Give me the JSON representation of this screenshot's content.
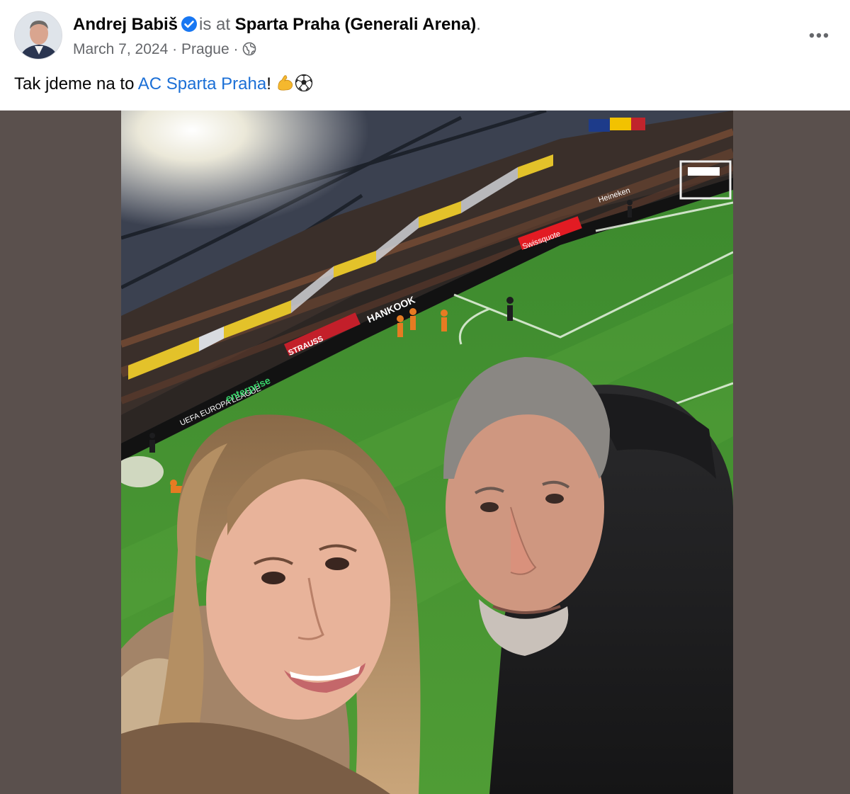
{
  "post": {
    "author": "Andrej Babiš",
    "is_at": "is at",
    "location": "Sparta Praha (Generali Arena)",
    "period": ".",
    "date": "March 7, 2024",
    "separator": "·",
    "city": "Prague",
    "audience_icon": "globe-icon",
    "verified_icon": "verified-badge-icon",
    "more_icon": "more-options-icon"
  },
  "caption": {
    "text_before": "Tak jdeme na to ",
    "mention": "AC Sparta Praha",
    "text_after": "!",
    "emoji": [
      "flexed-biceps-emoji",
      "soccer-ball-emoji"
    ]
  },
  "photo": {
    "signage": {
      "hankook": "HANKOOK",
      "strauss": "STRAUSS",
      "enterprise": "enterprise",
      "swissquote": "Swissquote",
      "europa_league": "UEFA EUROPA LEAGUE",
      "heineken": "Heineken"
    }
  },
  "colors": {
    "link": "#1b6fd6",
    "muted": "#65676b",
    "verified": "#1877f2",
    "media_bg": "#5a504d"
  }
}
